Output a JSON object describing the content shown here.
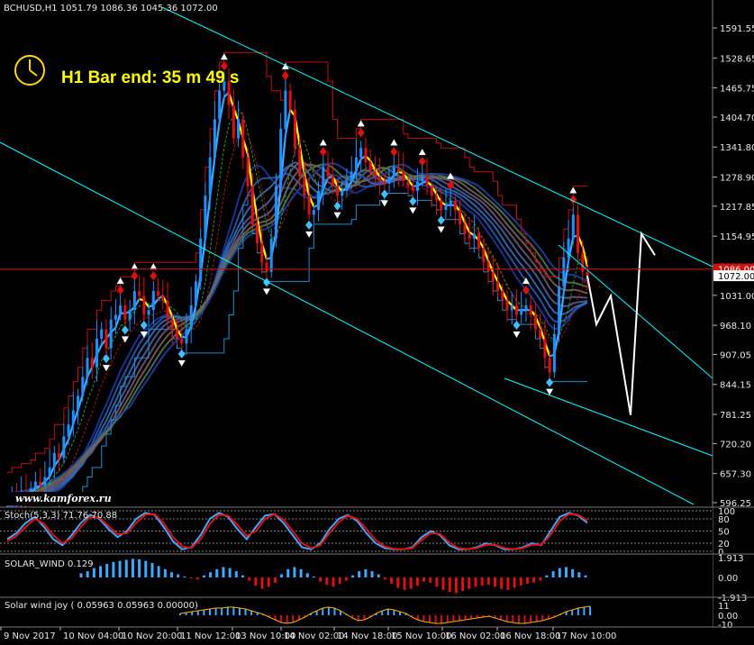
{
  "header": {
    "text": "BCHUSD,H1  1051.79 1086.36 1045.36 1072.00"
  },
  "timer": {
    "text": "H1 Bar end: 35 m 49 s"
  },
  "watermark": {
    "text": "www.kamforex.ru"
  },
  "subpanels": {
    "stoch": {
      "label": "Stoch(5,3,3) 71.76 70.88"
    },
    "solar": {
      "label": "SOLAR_WIND 0.129"
    },
    "solar_joy": {
      "label": "Solar wind joy ( 0.05963 0.05963 0.00000)"
    }
  },
  "chart_data": [
    {
      "type": "candlestick",
      "symbol": "BCHUSD",
      "timeframe": "H1",
      "ohlc_last": {
        "open": 1051.79,
        "high": 1086.36,
        "low": 1045.36,
        "close": 1072.0
      },
      "price_ticks": [
        1591.55,
        1528.65,
        1465.75,
        1404.7,
        1341.8,
        1278.9,
        1217.85,
        1154.95,
        1092.05,
        1031.0,
        968.1,
        907.05,
        844.15,
        781.25,
        720.2,
        657.3,
        596.25
      ],
      "current_price": 1072.0,
      "price_line": 1086.0,
      "price_labels_highlighted": [
        "1086.00",
        "1072.00"
      ],
      "ylim": [
        596.25,
        1640
      ],
      "time_labels": [
        "9 Nov 2017",
        "10 Nov 04:00",
        "10 Nov 20:00",
        "11 Nov 12:00",
        "13 Nov 10:00",
        "14 Nov 02:00",
        "14 Nov 18:00",
        "15 Nov 10:00",
        "16 Nov 02:00",
        "16 Nov 18:00",
        "17 Nov 10:00"
      ],
      "candles_close": [
        600,
        610,
        604,
        618,
        612,
        626,
        640,
        632,
        650,
        670,
        700,
        690,
        735,
        760,
        790,
        820,
        860,
        900,
        880,
        940,
        960,
        920,
        980,
        990,
        1010,
        980,
        1000,
        1040,
        1030,
        990,
        1000,
        1040,
        1030,
        1020,
        980,
        960,
        940,
        930,
        960,
        1010,
        1060,
        1150,
        1240,
        1320,
        1400,
        1460,
        1480,
        1430,
        1360,
        1400,
        1320,
        1260,
        1180,
        1140,
        1100,
        1080,
        1150,
        1260,
        1380,
        1460,
        1420,
        1340,
        1280,
        1240,
        1200,
        1210,
        1250,
        1300,
        1280,
        1260,
        1240,
        1250,
        1270,
        1290,
        1320,
        1340,
        1310,
        1290,
        1280,
        1270,
        1265,
        1280,
        1300,
        1290,
        1270,
        1260,
        1250,
        1270,
        1280,
        1260,
        1240,
        1230,
        1210,
        1220,
        1230,
        1210,
        1180,
        1160,
        1150,
        1160,
        1130,
        1100,
        1080,
        1060,
        1040,
        1020,
        1000,
        1010,
        990,
        1000,
        1010,
        990,
        960,
        940,
        900,
        870,
        950,
        1050,
        1110,
        1150,
        1200,
        1120,
        1080,
        1072
      ],
      "projection_close": [
        1072,
        970,
        1030,
        780,
        1160,
        1115
      ]
    },
    {
      "type": "line",
      "panel": "stoch",
      "levels": [
        100,
        80,
        50,
        20,
        0
      ],
      "ylim": [
        0,
        100
      ],
      "series": [
        {
          "name": "main",
          "values": [
            30,
            45,
            70,
            85,
            60,
            30,
            15,
            40,
            70,
            90,
            80,
            55,
            35,
            50,
            80,
            95,
            90,
            60,
            25,
            5,
            10,
            40,
            80,
            95,
            85,
            55,
            30,
            60,
            88,
            92,
            70,
            40,
            10,
            5,
            20,
            55,
            80,
            90,
            75,
            45,
            20,
            8,
            5,
            5,
            10,
            35,
            50,
            40,
            15,
            5,
            5,
            10,
            20,
            15,
            5,
            5,
            10,
            20,
            15,
            50,
            85,
            95,
            88,
            70
          ]
        },
        {
          "name": "signal",
          "values": [
            25,
            38,
            60,
            80,
            68,
            40,
            20,
            32,
            60,
            85,
            83,
            62,
            42,
            45,
            70,
            90,
            92,
            70,
            35,
            12,
            8,
            30,
            68,
            90,
            88,
            65,
            38,
            50,
            80,
            92,
            78,
            50,
            20,
            8,
            15,
            45,
            72,
            88,
            80,
            55,
            28,
            12,
            6,
            5,
            8,
            28,
            45,
            43,
            22,
            8,
            5,
            8,
            16,
            16,
            8,
            5,
            8,
            16,
            16,
            40,
            75,
            92,
            90,
            76
          ]
        }
      ]
    },
    {
      "type": "bar",
      "panel": "solar_wind",
      "levels": [
        1.913,
        0.0,
        -1.913
      ],
      "ylim": [
        -1.913,
        1.913
      ],
      "values": [
        0.4,
        0.6,
        0.9,
        1.1,
        1.3,
        1.5,
        1.6,
        1.7,
        1.8,
        1.75,
        1.6,
        1.4,
        1.1,
        0.8,
        0.5,
        0.3,
        0.1,
        -0.1,
        -0.2,
        0.2,
        0.5,
        0.8,
        1.0,
        0.9,
        0.6,
        0.2,
        -0.3,
        -0.8,
        -1.1,
        -0.9,
        -0.5,
        0.3,
        0.8,
        1.0,
        0.8,
        0.4,
        0.1,
        -0.4,
        -0.7,
        -0.9,
        -0.6,
        -0.3,
        0.2,
        0.6,
        0.8,
        0.6,
        0.3,
        -0.2,
        -0.6,
        -1.0,
        -1.2,
        -1.1,
        -0.8,
        -0.4,
        -0.5,
        -0.9,
        -1.2,
        -1.4,
        -1.5,
        -1.3,
        -1.1,
        -0.9,
        -0.8,
        -0.7,
        -0.9,
        -1.1,
        -1.2,
        -1.0,
        -0.8,
        -0.6,
        -0.5,
        -0.3,
        0.2,
        0.6,
        0.9,
        1.0,
        0.8,
        0.5,
        0.2
      ]
    },
    {
      "type": "bar",
      "panel": "solar_wind_joy",
      "levels": [
        11,
        0.0,
        -10
      ],
      "ylim": [
        -10,
        11
      ],
      "values": [
        2,
        3,
        4,
        5,
        6,
        7,
        8,
        8,
        9,
        9,
        8,
        7,
        5,
        3,
        1,
        -2,
        -5,
        -8,
        -9,
        -8,
        -5,
        -2,
        2,
        5,
        8,
        9,
        8,
        5,
        1,
        -3,
        -6,
        -5,
        -2,
        2,
        5,
        7,
        6,
        4,
        2,
        -2,
        -5,
        -7,
        -8,
        -9,
        -9,
        -8,
        -7,
        -6,
        -5,
        -4,
        -3,
        -2,
        -1,
        -3,
        -5,
        -7,
        -8,
        -9,
        -9,
        -8,
        -7,
        -6,
        -4,
        -2,
        1,
        4,
        6,
        8,
        9,
        10
      ]
    }
  ]
}
